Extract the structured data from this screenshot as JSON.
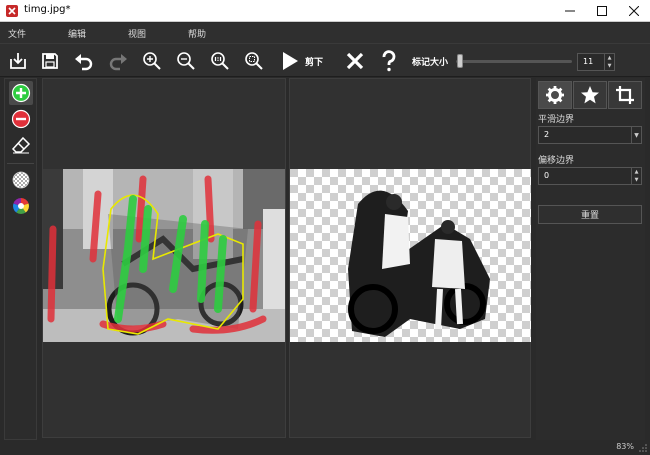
{
  "window": {
    "title": "timg.jpg*"
  },
  "menu": [
    "文件",
    "编辑",
    "视图",
    "帮助"
  ],
  "toolbar": {
    "cut_label": "剪下",
    "mark_size_label": "标记大小",
    "mark_size_value": "11",
    "mark_size_fraction": 0.02
  },
  "panel": {
    "smooth_label": "平滑边界",
    "smooth_value": "2",
    "offset_label": "偏移边界",
    "offset_value": "0",
    "reset_label": "重置"
  },
  "status": {
    "zoom": "83%"
  },
  "icons": {
    "app": "app-icon",
    "import": "import-icon",
    "save": "save-icon",
    "undo": "undo-icon",
    "redo": "redo-icon",
    "zoom_in": "zoom-in-icon",
    "zoom_out": "zoom-out-icon",
    "actual_size": "actual-size-icon",
    "fit": "fit-to-window-icon",
    "play": "play-icon",
    "close": "close-icon",
    "help": "question-icon",
    "add_mark": "add-mark-icon",
    "remove_mark": "remove-mark-icon",
    "eraser": "eraser-icon",
    "background": "transparent-background-icon",
    "color": "color-wheel-icon",
    "settings": "gear-icon",
    "effects": "star-icon",
    "crop": "crop-icon"
  },
  "colors": {
    "add": "#2ecc40",
    "remove": "#e0303a",
    "accent": "#ffffff"
  }
}
